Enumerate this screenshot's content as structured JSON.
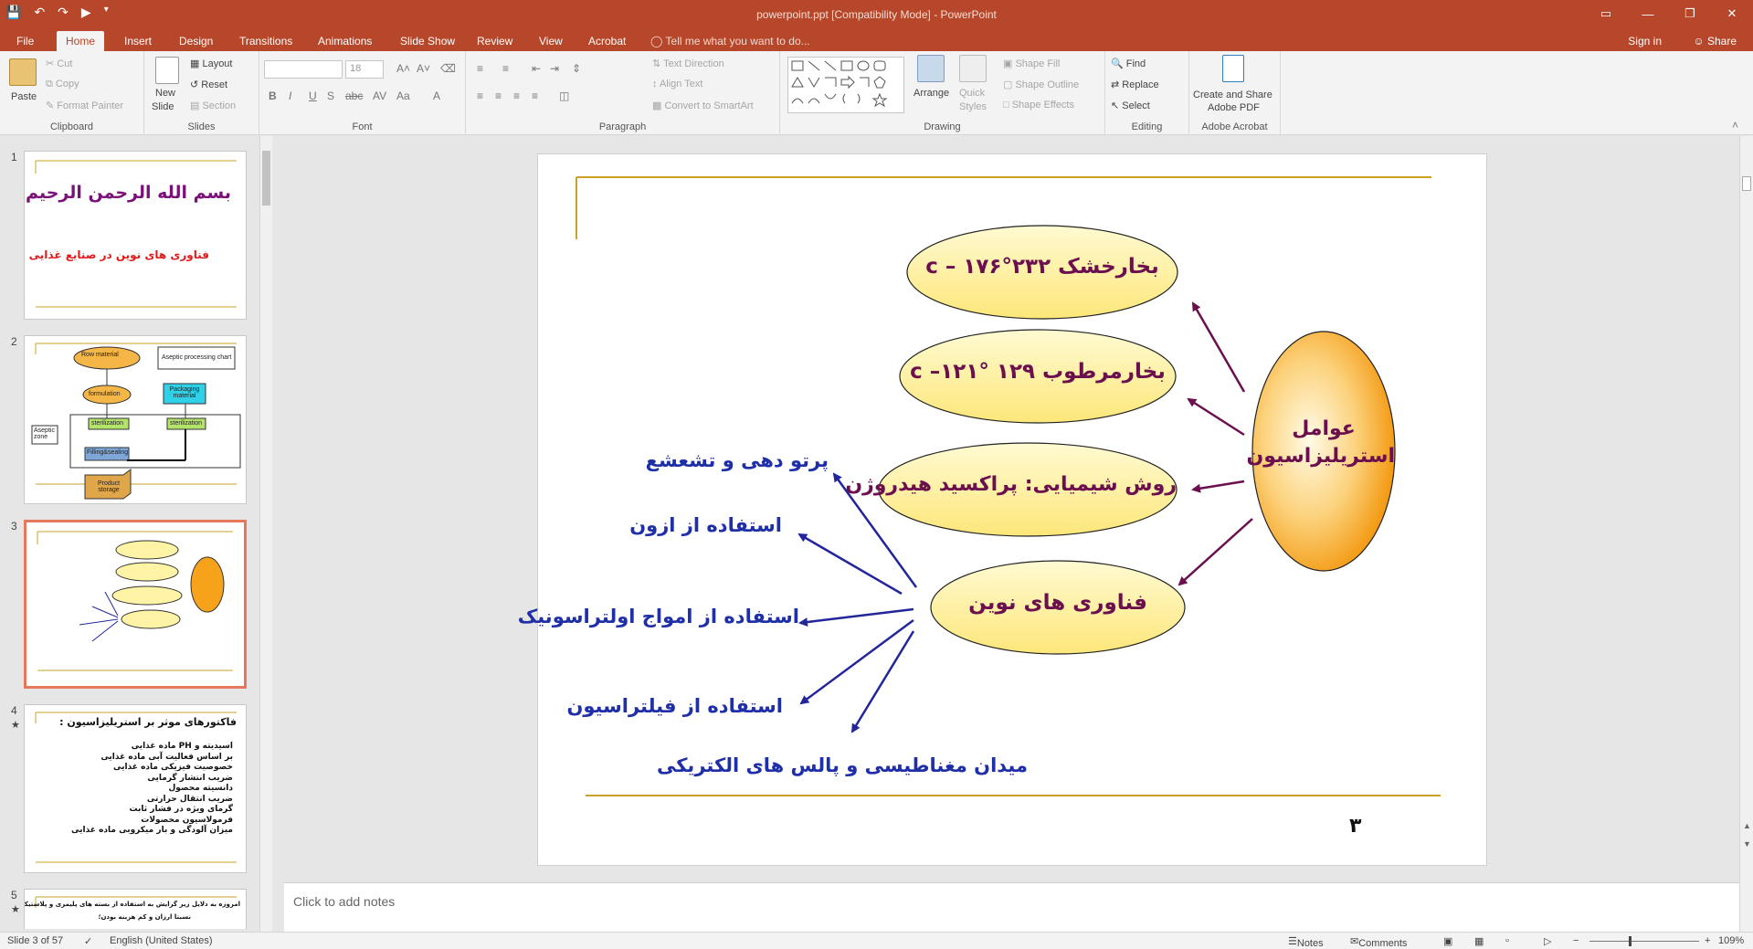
{
  "window": {
    "title": "powerpoint.ppt [Compatibility Mode] - PowerPoint",
    "minimize": "—",
    "restore": "❐",
    "close": "✕",
    "ribbon_display_icon": "▭"
  },
  "qat": {
    "save_icon": "save-icon",
    "undo_icon": "undo-icon",
    "redo_icon": "redo-icon",
    "start_icon": "start-from-beginning-icon"
  },
  "tabs": [
    "File",
    "Home",
    "Insert",
    "Design",
    "Transitions",
    "Animations",
    "Slide Show",
    "Review",
    "View",
    "Acrobat"
  ],
  "active_tab": "Home",
  "tellme": "Tell me what you want to do...",
  "signin": "Sign in",
  "share": "Share",
  "ribbon": {
    "clipboard": {
      "label": "Clipboard",
      "paste": "Paste",
      "cut": "Cut",
      "copy": "Copy",
      "format_painter": "Format Painter"
    },
    "slides": {
      "label": "Slides",
      "new_slide": "New",
      "new_slide2": "Slide",
      "layout": "Layout",
      "reset": "Reset",
      "section": "Section"
    },
    "font": {
      "label": "Font",
      "font_name": "",
      "font_size": "18"
    },
    "paragraph": {
      "label": "Paragraph",
      "text_direction": "Text Direction",
      "align_text": "Align Text",
      "smartart": "Convert to SmartArt"
    },
    "drawing": {
      "label": "Drawing",
      "arrange": "Arrange",
      "quick_styles": "Quick",
      "quick_styles2": "Styles",
      "shape_fill": "Shape Fill",
      "shape_outline": "Shape Outline",
      "shape_effects": "Shape Effects"
    },
    "editing": {
      "label": "Editing",
      "find": "Find",
      "replace": "Replace",
      "select": "Select"
    },
    "acrobat": {
      "label": "Adobe Acrobat",
      "create": "Create and Share",
      "create2": "Adobe PDF"
    }
  },
  "thumbnails": [
    {
      "num": "1",
      "star": "",
      "title": "بسم الله الرحمن الرحیم",
      "subtitle": "فناوری های نوین در صنایع غذایی"
    },
    {
      "num": "2",
      "star": "",
      "boxes": [
        "Row material",
        "Aseptic processing chart",
        "formulation",
        "Packaging material",
        "sterilization",
        "sterilization",
        "Aseptic zone",
        "Filling&sealing",
        "Product storage"
      ]
    },
    {
      "num": "3",
      "star": ""
    },
    {
      "num": "4",
      "star": "★",
      "title": "فاکتورهای موثر بر استریلیزاسیون :",
      "items": [
        "اسیدیته و PH ماده غذایی",
        "بر اساس فعالیت آبی ماده غذایی",
        "خصوصیت فیزیکی ماده غذایی",
        "ضریب انتشار گرمایی",
        "دانسیته محصول",
        "ضریب انتقال حرارتی",
        "گرمای ویژه در فشار ثابت",
        "فرمولاسیون محصولات",
        "میزان آلودگی و بار میکروبی ماده غذایی"
      ]
    },
    {
      "num": "5",
      "star": "★",
      "title": "امروزه به دلایل زیر گرایش به استفاده از بسته های پلیمری و پلاستیکی می رود :",
      "line": "نسبتا ارزان و کم هزینه بودن؛"
    }
  ],
  "slide": {
    "ellipse_main": [
      "عوامل",
      "استریلیزاسیون"
    ],
    "ellipse1": "بخارخشک ۲۳۲°c – ۱۷۶",
    "ellipse2": "بخارمرطوب ۱۲۹ °c –۱۲۱",
    "ellipse3": "روش شیمیایی: پراکسید هیدروژن",
    "ellipse4": "فناوری های نوین",
    "item1": "پرتو دهی و تشعشع",
    "item2": "استفاده از ازون",
    "item3": "استفاده از امواج اولتراسونیک",
    "item4": "استفاده از فیلتراسیون",
    "item5": "میدان مغناطیسی و پالس های الکتریکی",
    "page_number": "۳",
    "colors": {
      "gold_line": "#c9a227",
      "arrow_maroon": "#6b0f4e",
      "arrow_blue": "#23269b",
      "ellipse_fill": "#fff3a6",
      "main_fill": "#f7a21b"
    }
  },
  "notes_placeholder": "Click to add notes",
  "status": {
    "slide_info": "Slide 3 of 57",
    "language": "English (United States)",
    "notes": "Notes",
    "comments": "Comments",
    "zoom": "109%"
  }
}
